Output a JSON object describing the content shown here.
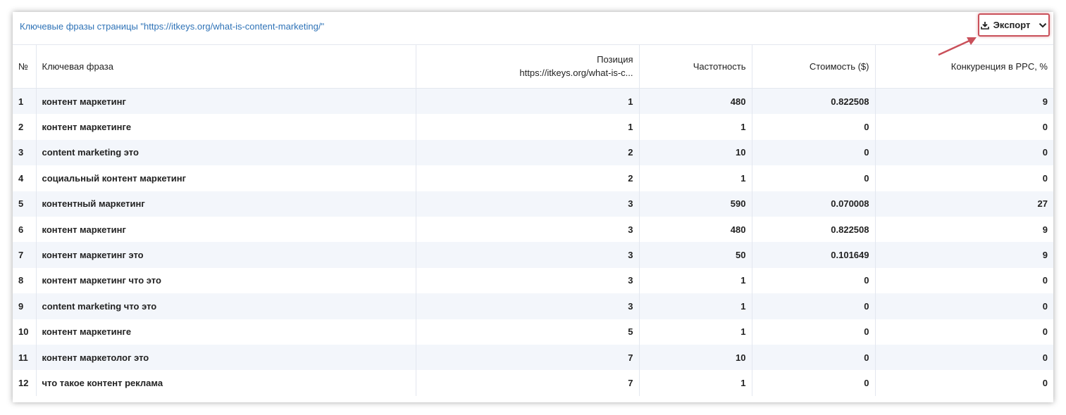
{
  "title": "Ключевые фразы страницы \"https://itkeys.org/what-is-content-marketing/\"",
  "export": {
    "label": "Экспорт",
    "icon": "download-icon",
    "dropdown_icon": "chevron-down-icon"
  },
  "highlight_color": "#c9505a",
  "columns": {
    "num": "№",
    "phrase": "Ключевая фраза",
    "position_line1": "Позиция",
    "position_line2": "https://itkeys.org/what-is-c...",
    "frequency": "Частотность",
    "cost": "Стоимость ($)",
    "competition": "Конкуренция в PPC, %"
  },
  "rows": [
    {
      "num": "1",
      "phrase": "контент маркетинг",
      "position": "1",
      "frequency": "480",
      "cost": "0.822508",
      "competition": "9"
    },
    {
      "num": "2",
      "phrase": "контент маркетинге",
      "position": "1",
      "frequency": "1",
      "cost": "0",
      "competition": "0"
    },
    {
      "num": "3",
      "phrase": "content marketing это",
      "position": "2",
      "frequency": "10",
      "cost": "0",
      "competition": "0"
    },
    {
      "num": "4",
      "phrase": "социальный контент маркетинг",
      "position": "2",
      "frequency": "1",
      "cost": "0",
      "competition": "0"
    },
    {
      "num": "5",
      "phrase": "контентный маркетинг",
      "position": "3",
      "frequency": "590",
      "cost": "0.070008",
      "competition": "27"
    },
    {
      "num": "6",
      "phrase": "контент маркетинг",
      "position": "3",
      "frequency": "480",
      "cost": "0.822508",
      "competition": "9"
    },
    {
      "num": "7",
      "phrase": "контент маркетинг это",
      "position": "3",
      "frequency": "50",
      "cost": "0.101649",
      "competition": "9"
    },
    {
      "num": "8",
      "phrase": "контент маркетинг что это",
      "position": "3",
      "frequency": "1",
      "cost": "0",
      "competition": "0"
    },
    {
      "num": "9",
      "phrase": "content marketing что это",
      "position": "3",
      "frequency": "1",
      "cost": "0",
      "competition": "0"
    },
    {
      "num": "10",
      "phrase": "контент маркетинге",
      "position": "5",
      "frequency": "1",
      "cost": "0",
      "competition": "0"
    },
    {
      "num": "11",
      "phrase": "контент маркетолог это",
      "position": "7",
      "frequency": "10",
      "cost": "0",
      "competition": "0"
    },
    {
      "num": "12",
      "phrase": "что такое контент реклама",
      "position": "7",
      "frequency": "1",
      "cost": "0",
      "competition": "0"
    }
  ]
}
